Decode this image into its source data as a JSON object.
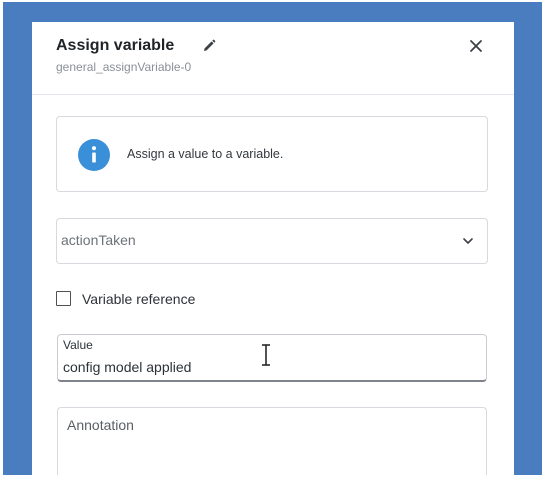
{
  "dialog": {
    "title": "Assign variable",
    "subtitle": "general_assignVariable-0",
    "edit_icon": "pencil-icon",
    "close_icon": "close-icon"
  },
  "info": {
    "icon": "info-icon",
    "icon_color": "#3a8fd9",
    "text": "Assign a value to a variable."
  },
  "variable_select": {
    "value": "actionTaken",
    "icon": "chevron-down-icon"
  },
  "variable_reference": {
    "label": "Variable reference",
    "checked": false
  },
  "value_field": {
    "label": "Value",
    "value": "config model applied"
  },
  "annotation_field": {
    "label": "Annotation",
    "value": ""
  },
  "colors": {
    "background_frame": "#4a7dbf",
    "panel": "#ffffff",
    "border": "#d6d9dd"
  }
}
